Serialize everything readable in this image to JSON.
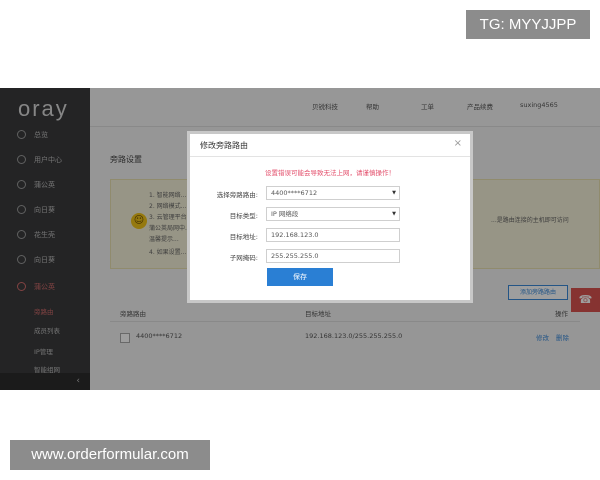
{
  "overlay_tags": {
    "top_right": "TG: MYYJJPP",
    "bottom_left": "www.orderformular.com"
  },
  "sidebar": {
    "logo": "oray",
    "items": [
      {
        "label": "总览",
        "icon": "grid-icon"
      },
      {
        "label": "用户中心",
        "icon": "user-icon"
      },
      {
        "label": "蒲公英",
        "icon": "network-icon"
      },
      {
        "label": "向日葵",
        "icon": "remote-icon"
      },
      {
        "label": "花生壳",
        "icon": "peanut-icon"
      },
      {
        "label": "向日葵",
        "icon": "sun-icon"
      },
      {
        "label": "蒲公英",
        "icon": "dandelion-icon"
      }
    ],
    "subitems": [
      "旁路由",
      "成员列表",
      "IP管理",
      "智能组网"
    ],
    "collapse": "‹"
  },
  "topbar": {
    "items": [
      "贝锐科技",
      "帮助",
      "工单",
      "产品续费",
      "suxing4565"
    ]
  },
  "main": {
    "title": "旁路设置",
    "tips": [
      "1. 智能网络...",
      "2. 网络模式...",
      "3. 云管理平台...",
      "蒲公英局网中...",
      "温馨提示...",
      "4. 如果设置..."
    ],
    "tip_right": "...是路由连接的主机即可访问",
    "add_button": "添加旁路路由",
    "table": {
      "headers": [
        "旁路路由",
        "目标地址",
        "操作"
      ],
      "rows": [
        {
          "router": "4400****6712",
          "target": "192.168.123.0/255.255.255.0",
          "actions": [
            "修改",
            "删除"
          ]
        }
      ]
    }
  },
  "modal": {
    "title": "修改旁路路由",
    "close": "×",
    "warning": "设置错误可能会导致无法上网，请谨慎操作！",
    "fields": [
      {
        "label": "选择旁路路由:",
        "value": "4400****6712",
        "type": "select"
      },
      {
        "label": "目标类型:",
        "value": "IP 网络段",
        "type": "select"
      },
      {
        "label": "目标地址:",
        "value": "192.168.123.0",
        "type": "input"
      },
      {
        "label": "子网掩码:",
        "value": "255.255.255.0",
        "type": "input"
      }
    ],
    "save": "保存"
  },
  "colors": {
    "accent": "#2a7fd4",
    "warning": "#e34d6a",
    "sidebar": "#3a3b3d"
  }
}
